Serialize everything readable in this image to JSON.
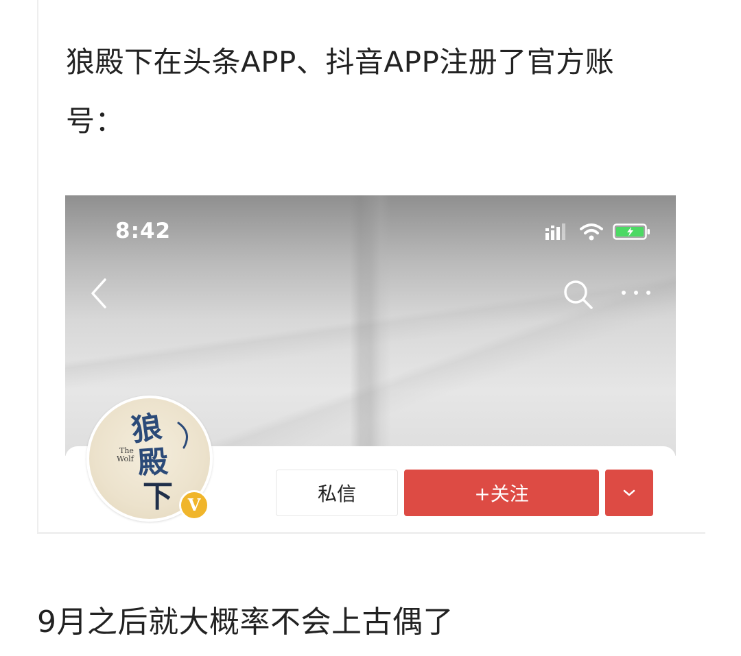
{
  "post": {
    "intro_text": "狼殿下在头条APP、抖音APP注册了官方账号：",
    "bottom_text": "9月之后就大概率不会上古偶了"
  },
  "screenshot": {
    "status_bar": {
      "time": "8:42",
      "icons": [
        "signal-icon",
        "wifi-icon",
        "battery-charging-icon"
      ]
    },
    "nav": {
      "icons": [
        "back-icon",
        "search-icon",
        "more-icon"
      ]
    },
    "profile": {
      "avatar_text": "狼殿下",
      "avatar_subtext": "The Wolf",
      "verified_badge": "V",
      "message_label": "私信",
      "follow_label": "+关注",
      "dropdown_icon": "chevron-down-icon"
    },
    "colors": {
      "accent_red": "#dd4b44",
      "badge_gold": "#f0b52b",
      "battery_green": "#4cd964"
    }
  }
}
